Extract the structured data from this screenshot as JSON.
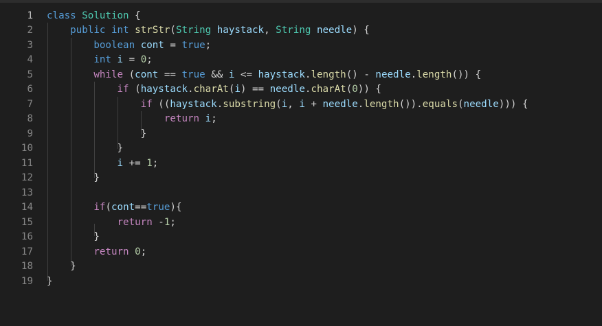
{
  "colors": {
    "background": "#1e1e1e",
    "line_number": "#858585",
    "keyword": "#569cd6",
    "control": "#c586c0",
    "function": "#dcdcaa",
    "type": "#4ec9b0",
    "variable": "#9cdcfe",
    "number": "#b5cea8",
    "text": "#d4d4d4"
  },
  "lines": [
    {
      "n": "1",
      "tokens": [
        [
          "kw",
          "class"
        ],
        [
          "op",
          " "
        ],
        [
          "cls",
          "Solution"
        ],
        [
          "op",
          " {"
        ]
      ]
    },
    {
      "n": "2",
      "tokens": [
        [
          "op",
          "    "
        ],
        [
          "kw",
          "public"
        ],
        [
          "op",
          " "
        ],
        [
          "kw",
          "int"
        ],
        [
          "op",
          " "
        ],
        [
          "fn",
          "strStr"
        ],
        [
          "op",
          "("
        ],
        [
          "cls",
          "String"
        ],
        [
          "op",
          " "
        ],
        [
          "var",
          "haystack"
        ],
        [
          "op",
          ", "
        ],
        [
          "cls",
          "String"
        ],
        [
          "op",
          " "
        ],
        [
          "var",
          "needle"
        ],
        [
          "op",
          ") {"
        ]
      ]
    },
    {
      "n": "3",
      "tokens": [
        [
          "op",
          "        "
        ],
        [
          "kw",
          "boolean"
        ],
        [
          "op",
          " "
        ],
        [
          "var",
          "cont"
        ],
        [
          "op",
          " = "
        ],
        [
          "kw",
          "true"
        ],
        [
          "op",
          ";"
        ]
      ]
    },
    {
      "n": "4",
      "tokens": [
        [
          "op",
          "        "
        ],
        [
          "kw",
          "int"
        ],
        [
          "op",
          " "
        ],
        [
          "var",
          "i"
        ],
        [
          "op",
          " = "
        ],
        [
          "num",
          "0"
        ],
        [
          "op",
          ";"
        ]
      ]
    },
    {
      "n": "5",
      "tokens": [
        [
          "op",
          "        "
        ],
        [
          "ctl",
          "while"
        ],
        [
          "op",
          " ("
        ],
        [
          "var",
          "cont"
        ],
        [
          "op",
          " == "
        ],
        [
          "kw",
          "true"
        ],
        [
          "op",
          " && "
        ],
        [
          "var",
          "i"
        ],
        [
          "op",
          " <= "
        ],
        [
          "var",
          "haystack"
        ],
        [
          "op",
          "."
        ],
        [
          "fn",
          "length"
        ],
        [
          "op",
          "() - "
        ],
        [
          "var",
          "needle"
        ],
        [
          "op",
          "."
        ],
        [
          "fn",
          "length"
        ],
        [
          "op",
          "()) {"
        ]
      ]
    },
    {
      "n": "6",
      "tokens": [
        [
          "op",
          "            "
        ],
        [
          "ctl",
          "if"
        ],
        [
          "op",
          " ("
        ],
        [
          "var",
          "haystack"
        ],
        [
          "op",
          "."
        ],
        [
          "fn",
          "charAt"
        ],
        [
          "op",
          "("
        ],
        [
          "var",
          "i"
        ],
        [
          "op",
          ") == "
        ],
        [
          "var",
          "needle"
        ],
        [
          "op",
          "."
        ],
        [
          "fn",
          "charAt"
        ],
        [
          "op",
          "("
        ],
        [
          "num",
          "0"
        ],
        [
          "op",
          ")) {"
        ]
      ]
    },
    {
      "n": "7",
      "tokens": [
        [
          "op",
          "                "
        ],
        [
          "ctl",
          "if"
        ],
        [
          "op",
          " (("
        ],
        [
          "var",
          "haystack"
        ],
        [
          "op",
          "."
        ],
        [
          "fn",
          "substring"
        ],
        [
          "op",
          "("
        ],
        [
          "var",
          "i"
        ],
        [
          "op",
          ", "
        ],
        [
          "var",
          "i"
        ],
        [
          "op",
          " + "
        ],
        [
          "var",
          "needle"
        ],
        [
          "op",
          "."
        ],
        [
          "fn",
          "length"
        ],
        [
          "op",
          "())."
        ],
        [
          "fn",
          "equals"
        ],
        [
          "op",
          "("
        ],
        [
          "var",
          "needle"
        ],
        [
          "op",
          "))) {"
        ]
      ]
    },
    {
      "n": "8",
      "tokens": [
        [
          "op",
          "                    "
        ],
        [
          "ctl",
          "return"
        ],
        [
          "op",
          " "
        ],
        [
          "var",
          "i"
        ],
        [
          "op",
          ";"
        ]
      ]
    },
    {
      "n": "9",
      "tokens": [
        [
          "op",
          "                }"
        ]
      ]
    },
    {
      "n": "10",
      "tokens": [
        [
          "op",
          "            }"
        ]
      ]
    },
    {
      "n": "11",
      "tokens": [
        [
          "op",
          "            "
        ],
        [
          "var",
          "i"
        ],
        [
          "op",
          " += "
        ],
        [
          "num",
          "1"
        ],
        [
          "op",
          ";"
        ]
      ]
    },
    {
      "n": "12",
      "tokens": [
        [
          "op",
          "        }"
        ]
      ]
    },
    {
      "n": "13",
      "tokens": []
    },
    {
      "n": "14",
      "tokens": [
        [
          "op",
          "        "
        ],
        [
          "ctl",
          "if"
        ],
        [
          "op",
          "("
        ],
        [
          "var",
          "cont"
        ],
        [
          "op",
          "=="
        ],
        [
          "kw",
          "true"
        ],
        [
          "op",
          "){"
        ]
      ]
    },
    {
      "n": "15",
      "tokens": [
        [
          "op",
          "            "
        ],
        [
          "ctl",
          "return"
        ],
        [
          "op",
          " -"
        ],
        [
          "num",
          "1"
        ],
        [
          "op",
          ";"
        ]
      ]
    },
    {
      "n": "16",
      "tokens": [
        [
          "op",
          "        }"
        ]
      ]
    },
    {
      "n": "17",
      "tokens": [
        [
          "op",
          "        "
        ],
        [
          "ctl",
          "return"
        ],
        [
          "op",
          " "
        ],
        [
          "num",
          "0"
        ],
        [
          "op",
          ";"
        ]
      ]
    },
    {
      "n": "18",
      "tokens": [
        [
          "op",
          "    }"
        ]
      ]
    },
    {
      "n": "19",
      "tokens": [
        [
          "op",
          "}"
        ]
      ]
    }
  ]
}
